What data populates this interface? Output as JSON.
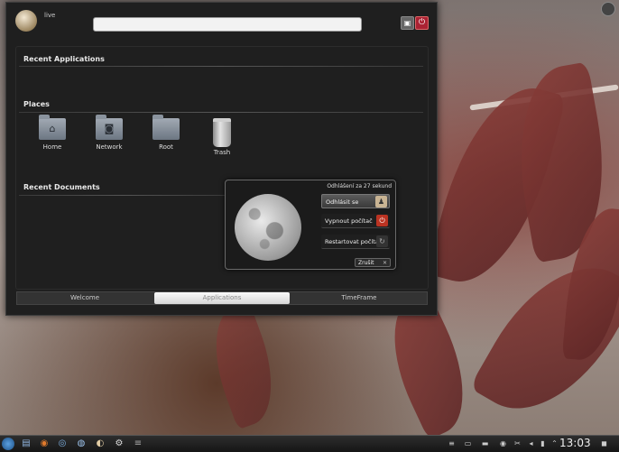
{
  "launcher": {
    "user_name": "live",
    "sections": {
      "recent_applications": "Recent Applications",
      "places": "Places",
      "recent_documents": "Recent Documents"
    },
    "places": [
      "Home",
      "Network",
      "Root",
      "Trash"
    ],
    "tabs": [
      "Welcome",
      "Applications",
      "TimeFrame"
    ],
    "active_tab": "Applications"
  },
  "logout_dialog": {
    "countdown": "Odhlášení za 27 sekund",
    "options": [
      "Odhlásit se",
      "Vypnout počítač",
      "Restartovat počítač"
    ],
    "cancel_label": "Zrušit"
  },
  "taskbar": {
    "clock": "13:03"
  },
  "colors": {
    "launcher_bg": "#1f1f1f",
    "power_red": "#b32222",
    "taskbar_bg": "#151515"
  }
}
